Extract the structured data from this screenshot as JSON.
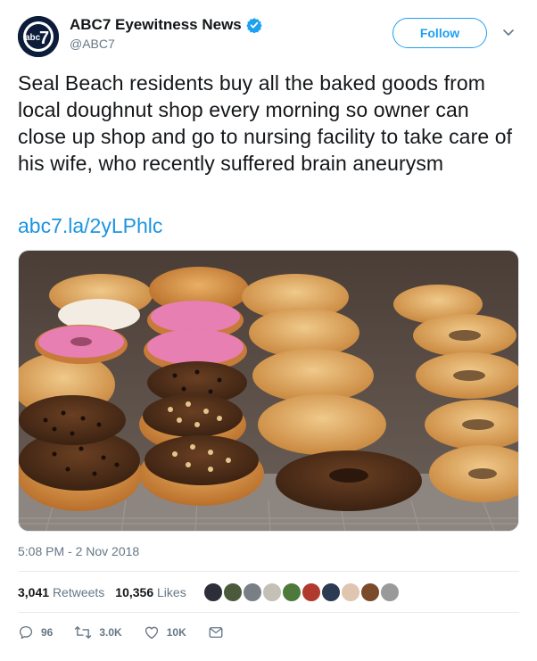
{
  "account": {
    "display_name": "ABC7 Eyewitness News",
    "handle": "@ABC7",
    "logo_text": "abc7",
    "verified_icon": "verified-badge-icon"
  },
  "header": {
    "follow_label": "Follow"
  },
  "tweet": {
    "text": "Seal Beach residents buy all the baked goods from local doughnut shop every morning so owner can close up shop and go to nursing facility to take care of his wife, who recently suffered brain aneurysm",
    "link": "abc7.la/2yLPhlc",
    "timestamp": "5:08 PM - 2 Nov 2018",
    "media": {
      "subject": "doughnut display case photo"
    }
  },
  "stats": {
    "retweets_count": "3,041",
    "retweets_label": "Retweets",
    "likes_count": "10,356",
    "likes_label": "Likes",
    "liker_avatars": 10
  },
  "actions": {
    "replies": "96",
    "retweets": "3.0K",
    "likes": "10K"
  },
  "colors": {
    "accent": "#1da1f2",
    "link": "#1b95e0",
    "muted": "#657786"
  }
}
